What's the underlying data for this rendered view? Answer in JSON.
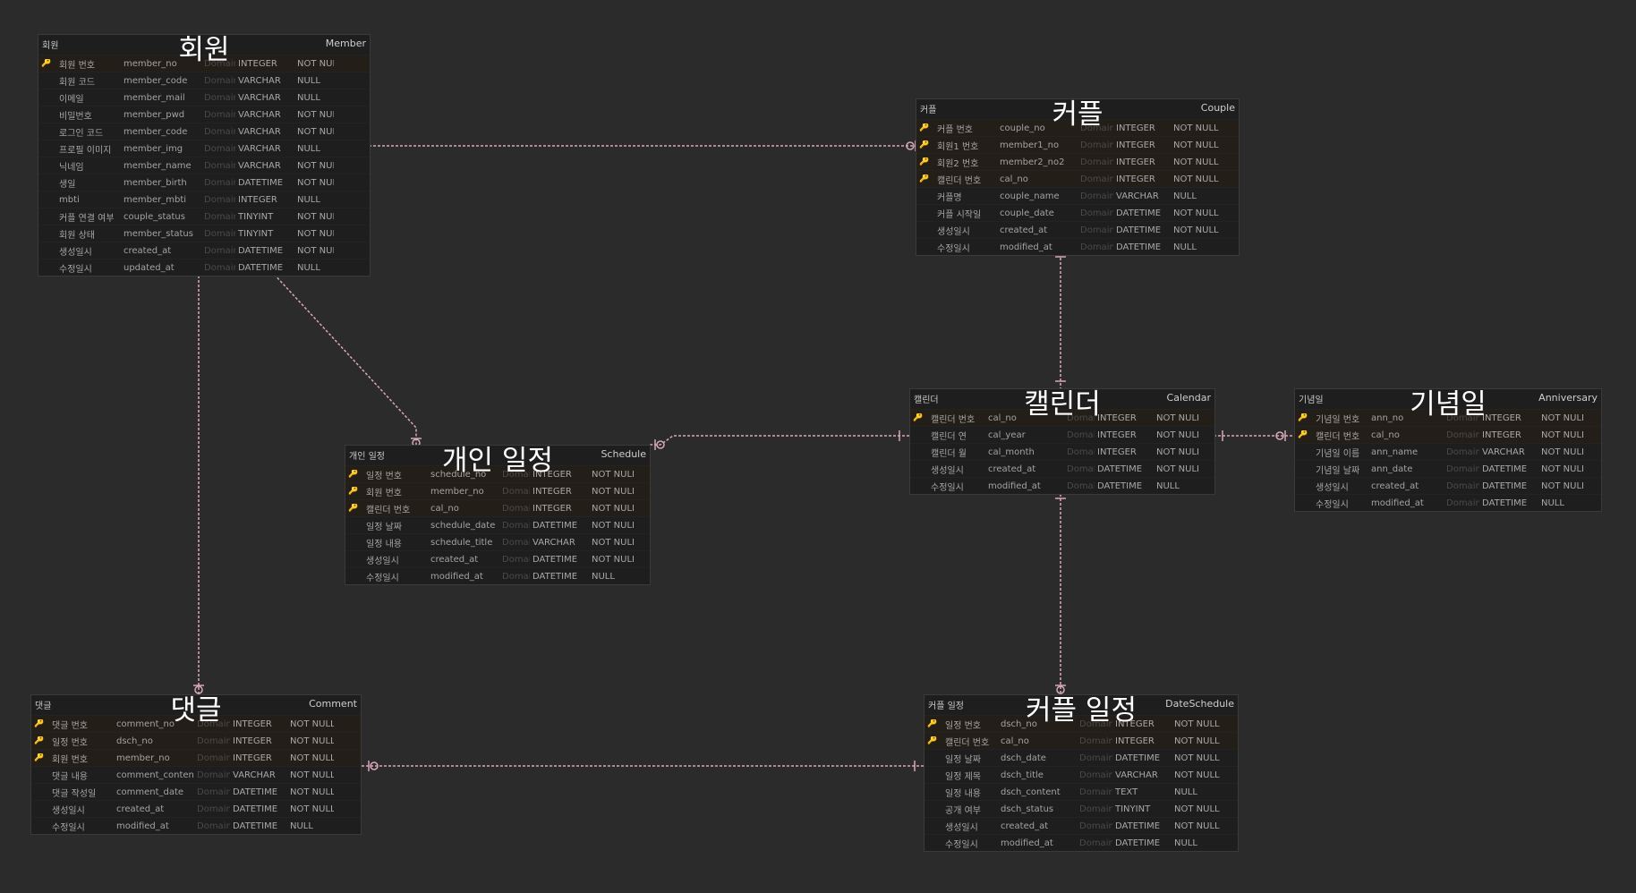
{
  "entities": [
    {
      "id": "member",
      "title": "회원",
      "logical_name": "회원",
      "physical_name": "Member",
      "columns": [
        {
          "pk": true,
          "name": "회원 번호",
          "field": "member_no",
          "domain": "Domain",
          "type": "INTEGER",
          "nullable": "NOT NULL"
        },
        {
          "pk": false,
          "name": "회원 코드",
          "field": "member_code",
          "domain": "Domain",
          "type": "VARCHAR",
          "nullable": "NULL"
        },
        {
          "pk": false,
          "name": "이메일",
          "field": "member_mail",
          "domain": "Domain",
          "type": "VARCHAR",
          "nullable": "NULL"
        },
        {
          "pk": false,
          "name": "비밀번호",
          "field": "member_pwd",
          "domain": "Domain",
          "type": "VARCHAR",
          "nullable": "NOT NULL"
        },
        {
          "pk": false,
          "name": "로그인 코드",
          "field": "member_code",
          "domain": "Domain",
          "type": "VARCHAR",
          "nullable": "NOT NULL"
        },
        {
          "pk": false,
          "name": "프로필 이미지",
          "field": "member_img",
          "domain": "Domain",
          "type": "VARCHAR",
          "nullable": "NULL"
        },
        {
          "pk": false,
          "name": "닉네임",
          "field": "member_name",
          "domain": "Domain",
          "type": "VARCHAR",
          "nullable": "NOT NULL"
        },
        {
          "pk": false,
          "name": "생일",
          "field": "member_birth",
          "domain": "Domain",
          "type": "DATETIME",
          "nullable": "NOT NULL"
        },
        {
          "pk": false,
          "name": "mbti",
          "field": "member_mbti",
          "domain": "Domain",
          "type": "INTEGER",
          "nullable": "NULL"
        },
        {
          "pk": false,
          "name": "커플 연결 여부",
          "field": "couple_status",
          "domain": "Domain",
          "type": "TINYINT",
          "nullable": "NOT NULL"
        },
        {
          "pk": false,
          "name": "회원 상태",
          "field": "member_status",
          "domain": "Domain",
          "type": "TINYINT",
          "nullable": "NOT NULL"
        },
        {
          "pk": false,
          "name": "생성일시",
          "field": "created_at",
          "domain": "Domain",
          "type": "DATETIME",
          "nullable": "NOT NULL"
        },
        {
          "pk": false,
          "name": "수정일시",
          "field": "updated_at",
          "domain": "Domain",
          "type": "DATETIME",
          "nullable": "NULL"
        }
      ]
    },
    {
      "id": "couple",
      "title": "커플",
      "logical_name": "커플",
      "physical_name": "Couple",
      "columns": [
        {
          "pk": true,
          "name": "커플 번호",
          "field": "couple_no",
          "domain": "Domain",
          "type": "INTEGER",
          "nullable": "NOT NULL"
        },
        {
          "pk": true,
          "name": "회원1 번호",
          "field": "member1_no",
          "domain": "Domain",
          "type": "INTEGER",
          "nullable": "NOT NULL"
        },
        {
          "pk": true,
          "name": "회원2 번호",
          "field": "member2_no2",
          "domain": "Domain",
          "type": "INTEGER",
          "nullable": "NOT NULL"
        },
        {
          "pk": true,
          "name": "캘린더 번호",
          "field": "cal_no",
          "domain": "Domain",
          "type": "INTEGER",
          "nullable": "NOT NULL"
        },
        {
          "pk": false,
          "name": "커플명",
          "field": "couple_name",
          "domain": "Domain",
          "type": "VARCHAR",
          "nullable": "NULL"
        },
        {
          "pk": false,
          "name": "커플 시작일",
          "field": "couple_date",
          "domain": "Domain",
          "type": "DATETIME",
          "nullable": "NOT NULL"
        },
        {
          "pk": false,
          "name": "생성일시",
          "field": "created_at",
          "domain": "Domain",
          "type": "DATETIME",
          "nullable": "NOT NULL"
        },
        {
          "pk": false,
          "name": "수정일시",
          "field": "modified_at",
          "domain": "Domain",
          "type": "DATETIME",
          "nullable": "NULL"
        }
      ]
    },
    {
      "id": "schedule",
      "title": "개인 일정",
      "logical_name": "개인 일정",
      "physical_name": "Schedule",
      "columns": [
        {
          "pk": true,
          "name": "일정 번호",
          "field": "schedule_no",
          "domain": "Domain",
          "type": "INTEGER",
          "nullable": "NOT NULL"
        },
        {
          "pk": true,
          "name": "회원 번호",
          "field": "member_no",
          "domain": "Domain",
          "type": "INTEGER",
          "nullable": "NOT NULL"
        },
        {
          "pk": true,
          "name": "캘린더 번호",
          "field": "cal_no",
          "domain": "Domain",
          "type": "INTEGER",
          "nullable": "NOT NULL"
        },
        {
          "pk": false,
          "name": "일정 날짜",
          "field": "schedule_date",
          "domain": "Domain",
          "type": "DATETIME",
          "nullable": "NOT NULL"
        },
        {
          "pk": false,
          "name": "일정 내용",
          "field": "schedule_title",
          "domain": "Domain",
          "type": "VARCHAR",
          "nullable": "NOT NULL"
        },
        {
          "pk": false,
          "name": "생성일시",
          "field": "created_at",
          "domain": "Domain",
          "type": "DATETIME",
          "nullable": "NOT NULL"
        },
        {
          "pk": false,
          "name": "수정일시",
          "field": "modified_at",
          "domain": "Domain",
          "type": "DATETIME",
          "nullable": "NULL"
        }
      ]
    },
    {
      "id": "calendar",
      "title": "캘린더",
      "logical_name": "캘린더",
      "physical_name": "Calendar",
      "columns": [
        {
          "pk": true,
          "name": "캘린더 번호",
          "field": "cal_no",
          "domain": "Domain",
          "type": "INTEGER",
          "nullable": "NOT NULL"
        },
        {
          "pk": false,
          "name": "캘린더 연",
          "field": "cal_year",
          "domain": "Domain",
          "type": "INTEGER",
          "nullable": "NOT NULL"
        },
        {
          "pk": false,
          "name": "캘린더 월",
          "field": "cal_month",
          "domain": "Domain",
          "type": "INTEGER",
          "nullable": "NOT NULL"
        },
        {
          "pk": false,
          "name": "생성일시",
          "field": "created_at",
          "domain": "Domain",
          "type": "DATETIME",
          "nullable": "NOT NULL"
        },
        {
          "pk": false,
          "name": "수정일시",
          "field": "modified_at",
          "domain": "Domain",
          "type": "DATETIME",
          "nullable": "NULL"
        }
      ]
    },
    {
      "id": "anniversary",
      "title": "기념일",
      "logical_name": "기념일",
      "physical_name": "Anniversary",
      "columns": [
        {
          "pk": true,
          "name": "기념일 번호",
          "field": "ann_no",
          "domain": "Domain",
          "type": "INTEGER",
          "nullable": "NOT NULL"
        },
        {
          "pk": true,
          "name": "캘린더 번호",
          "field": "cal_no",
          "domain": "Domain",
          "type": "INTEGER",
          "nullable": "NOT NULL"
        },
        {
          "pk": false,
          "name": "기념일 이름",
          "field": "ann_name",
          "domain": "Domain",
          "type": "VARCHAR",
          "nullable": "NOT NULL"
        },
        {
          "pk": false,
          "name": "기념일 날짜",
          "field": "ann_date",
          "domain": "Domain",
          "type": "DATETIME",
          "nullable": "NOT NULL"
        },
        {
          "pk": false,
          "name": "생성일시",
          "field": "created_at",
          "domain": "Domain",
          "type": "DATETIME",
          "nullable": "NOT NULL"
        },
        {
          "pk": false,
          "name": "수정일시",
          "field": "modified_at",
          "domain": "Domain",
          "type": "DATETIME",
          "nullable": "NULL"
        }
      ]
    },
    {
      "id": "comment",
      "title": "댓글",
      "logical_name": "댓글",
      "physical_name": "Comment",
      "columns": [
        {
          "pk": true,
          "name": "댓글 번호",
          "field": "comment_no",
          "domain": "Domain",
          "type": "INTEGER",
          "nullable": "NOT NULL"
        },
        {
          "pk": true,
          "name": "일정 번호",
          "field": "dsch_no",
          "domain": "Domain",
          "type": "INTEGER",
          "nullable": "NOT NULL"
        },
        {
          "pk": true,
          "name": "회원 번호",
          "field": "member_no",
          "domain": "Domain",
          "type": "INTEGER",
          "nullable": "NOT NULL"
        },
        {
          "pk": false,
          "name": "댓글 내용",
          "field": "comment_content",
          "domain": "Domain",
          "type": "VARCHAR",
          "nullable": "NOT NULL"
        },
        {
          "pk": false,
          "name": "댓글 작성일",
          "field": "comment_date",
          "domain": "Domain",
          "type": "DATETIME",
          "nullable": "NOT NULL"
        },
        {
          "pk": false,
          "name": "생성일시",
          "field": "created_at",
          "domain": "Domain",
          "type": "DATETIME",
          "nullable": "NOT NULL"
        },
        {
          "pk": false,
          "name": "수정일시",
          "field": "modified_at",
          "domain": "Domain",
          "type": "DATETIME",
          "nullable": "NULL"
        }
      ]
    },
    {
      "id": "dateschedule",
      "title": "커플 일정",
      "logical_name": "커플 일정",
      "physical_name": "DateSchedule",
      "columns": [
        {
          "pk": true,
          "name": "일정 번호",
          "field": "dsch_no",
          "domain": "Domain",
          "type": "INTEGER",
          "nullable": "NOT NULL"
        },
        {
          "pk": true,
          "name": "캘린더 번호",
          "field": "cal_no",
          "domain": "Domain",
          "type": "INTEGER",
          "nullable": "NOT NULL"
        },
        {
          "pk": false,
          "name": "일정 날짜",
          "field": "dsch_date",
          "domain": "Domain",
          "type": "DATETIME",
          "nullable": "NOT NULL"
        },
        {
          "pk": false,
          "name": "일정 제목",
          "field": "dsch_title",
          "domain": "Domain",
          "type": "VARCHAR",
          "nullable": "NOT NULL"
        },
        {
          "pk": false,
          "name": "일정 내용",
          "field": "dsch_content",
          "domain": "Domain",
          "type": "TEXT",
          "nullable": "NULL"
        },
        {
          "pk": false,
          "name": "공개 여부",
          "field": "dsch_status",
          "domain": "Domain",
          "type": "TINYINT",
          "nullable": "NOT NULL"
        },
        {
          "pk": false,
          "name": "생성일시",
          "field": "created_at",
          "domain": "Domain",
          "type": "DATETIME",
          "nullable": "NOT NULL"
        },
        {
          "pk": false,
          "name": "수정일시",
          "field": "modified_at",
          "domain": "Domain",
          "type": "DATETIME",
          "nullable": "NULL"
        }
      ]
    }
  ],
  "relationships": [
    {
      "from": "member",
      "to": "couple"
    },
    {
      "from": "member",
      "to": "schedule"
    },
    {
      "from": "member",
      "to": "comment"
    },
    {
      "from": "couple",
      "to": "calendar"
    },
    {
      "from": "calendar",
      "to": "schedule"
    },
    {
      "from": "calendar",
      "to": "anniversary"
    },
    {
      "from": "calendar",
      "to": "dateschedule"
    },
    {
      "from": "dateschedule",
      "to": "comment"
    }
  ],
  "colors": {
    "background": "#2b2b2b",
    "entity": "#1e1e1e",
    "line": "#d9a8b8",
    "pk_icon": "#c98b2c"
  },
  "icons": {
    "pk": "key-icon"
  }
}
